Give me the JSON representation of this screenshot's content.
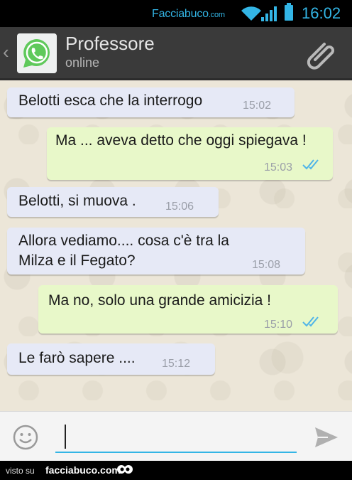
{
  "status_bar": {
    "brand": "Facciabuco",
    "brand_suffix": ".com",
    "time": "16:02",
    "accent_color": "#33b5e5"
  },
  "header": {
    "back_icon": "chevron-left-icon",
    "avatar_icon": "whatsapp-icon",
    "contact_name": "Professore",
    "contact_status": "online",
    "attach_icon": "paperclip-icon",
    "background_color": "#3a3a3a"
  },
  "messages": [
    {
      "direction": "in",
      "text": "Belotti esca che la interrogo",
      "time": "15:02"
    },
    {
      "direction": "out",
      "text": "Ma ... aveva detto che oggi spiegava !",
      "time": "15:03",
      "read": true
    },
    {
      "direction": "in",
      "text": "Belotti, si muova .",
      "time": "15:06"
    },
    {
      "direction": "in",
      "text": "Allora vediamo.... cosa c'è tra la Milza e il Fegato?",
      "time": "15:08"
    },
    {
      "direction": "out",
      "text": "Ma no, solo una grande amicizia !",
      "time": "15:10",
      "read": true
    },
    {
      "direction": "in",
      "text": "Le farò sapere ....",
      "time": "15:12"
    }
  ],
  "input_bar": {
    "emoji_icon": "smiley-icon",
    "message_value": "",
    "send_icon": "send-icon"
  },
  "footer": {
    "visto_su": "visto su",
    "brand": "facciabuco.com"
  },
  "colors": {
    "incoming_bubble": "#e6e9f6",
    "outgoing_bubble": "#e8f8c9",
    "read_ticks": "#4fb4e8"
  }
}
